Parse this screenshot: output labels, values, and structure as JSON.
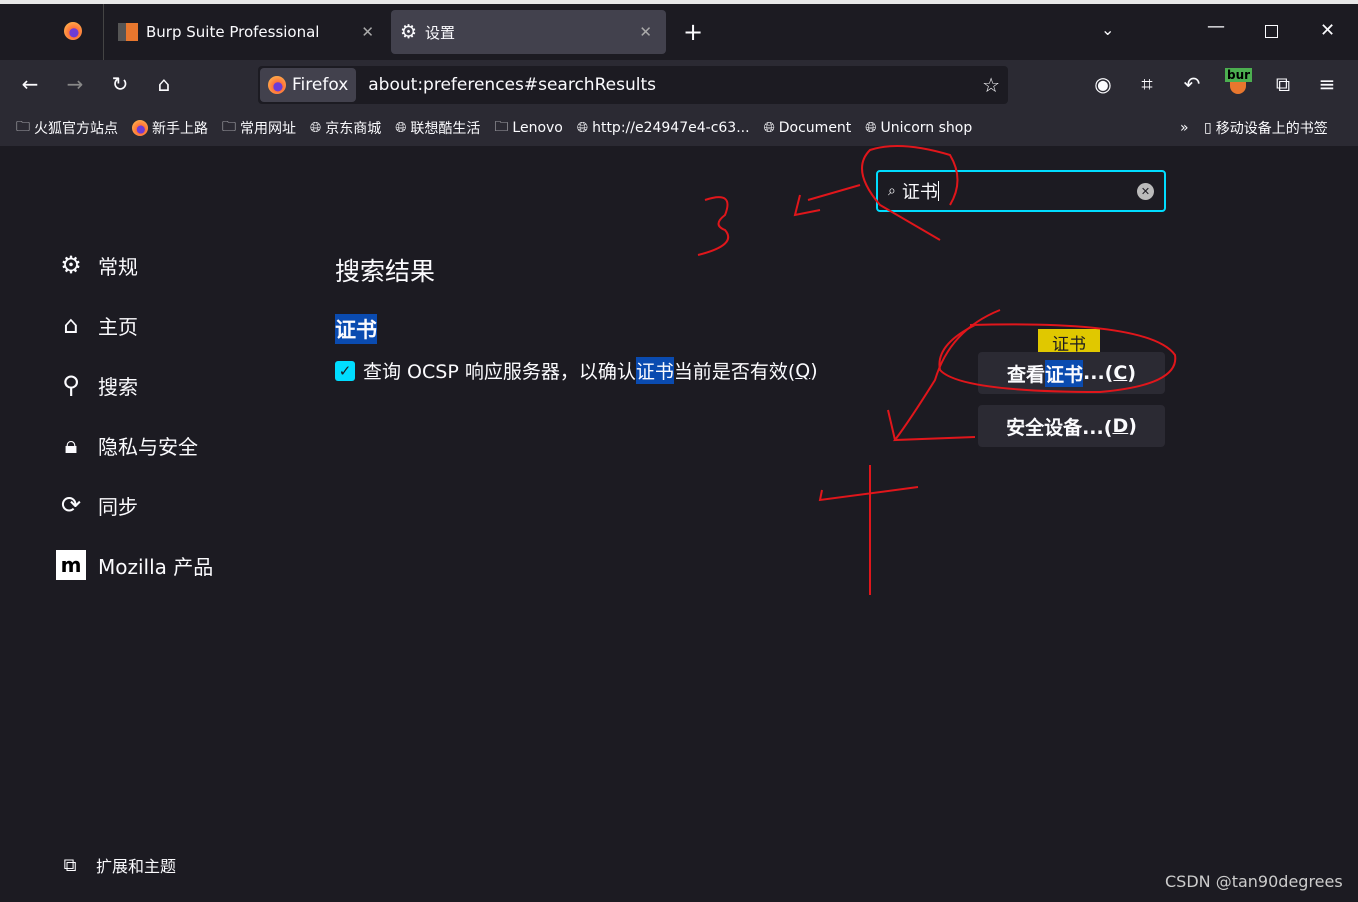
{
  "tabs": [
    {
      "label": "Burp Suite Professional"
    },
    {
      "label": "设置",
      "active": true
    }
  ],
  "nav": {
    "identity": "Firefox",
    "url": "about:preferences#searchResults"
  },
  "bookmarks": [
    "火狐官方站点",
    "新手上路",
    "常用网址",
    "京东商城",
    "联想酷生活",
    "Lenovo",
    "http://e24947e4-c63...",
    "Document",
    "Unicorn shop"
  ],
  "mobile_bookmarks": "移动设备上的书签",
  "toolbar": {
    "ext_badge": "bur"
  },
  "search": {
    "value": "证书"
  },
  "sidebar": {
    "items": [
      {
        "label": "常规",
        "icon": "gear-icon"
      },
      {
        "label": "主页",
        "icon": "home-icon"
      },
      {
        "label": "搜索",
        "icon": "search-icon"
      },
      {
        "label": "隐私与安全",
        "icon": "lock-icon"
      },
      {
        "label": "同步",
        "icon": "sync-icon"
      },
      {
        "label": "Mozilla 产品",
        "icon": "mozilla-icon"
      }
    ],
    "footer": "扩展和主题"
  },
  "main": {
    "title": "搜索结果",
    "section": "证书",
    "checkbox": {
      "checked": true,
      "pre": "查询 OCSP 响应服务器，以确认",
      "hl": "证书",
      "post": "当前是否有效(",
      "key": "Q",
      "end": ")"
    },
    "view_cert": {
      "pre": "查看",
      "hl": "证书",
      "post": "...(",
      "key": "C",
      "end": ")"
    },
    "security_devices": {
      "pre": "安全设备...(",
      "key": "D",
      "end": ")"
    },
    "tooltip": "证书"
  },
  "watermark": "CSDN @tan90degrees",
  "colors": {
    "accent": "#00ddff",
    "highlight": "#0a4bb0",
    "tooltip": "#e0c800",
    "annotation": "#e0161b"
  }
}
